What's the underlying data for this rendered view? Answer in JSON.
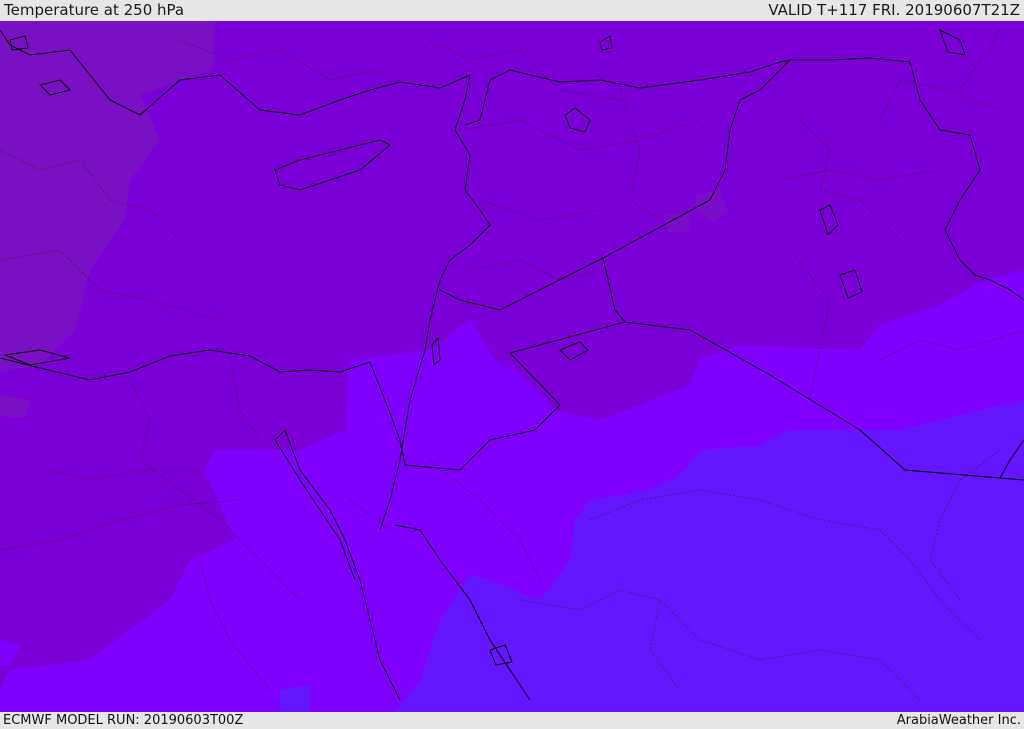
{
  "header": {
    "title": "Temperature at 250 hPa",
    "valid": "VALID T+117 FRI. 20190607T21Z"
  },
  "footer": {
    "model_run": "ECMWF MODEL RUN: 20190603T00Z",
    "brand": "ArabiaWeather Inc."
  },
  "map": {
    "field": "temperature",
    "level": "250 hPa",
    "zones": [
      {
        "id": "west",
        "color": "#7a10c4"
      },
      {
        "id": "central",
        "color": "#7b00d8"
      },
      {
        "id": "cold",
        "color": "#7f00ff"
      },
      {
        "id": "coldest",
        "color": "#6417ff"
      }
    ],
    "coastline_color": "#000000",
    "border_style": "dotted"
  }
}
